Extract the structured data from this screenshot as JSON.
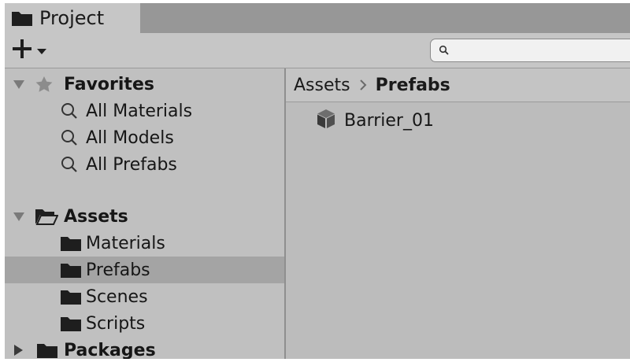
{
  "window": {
    "tab_label": "Project"
  },
  "toolbar": {
    "add_label": "+",
    "search_value": "",
    "search_placeholder": ""
  },
  "favorites": {
    "label": "Favorites",
    "items": [
      {
        "label": "All Materials",
        "icon": "search-icon"
      },
      {
        "label": "All Models",
        "icon": "search-icon"
      },
      {
        "label": "All Prefabs",
        "icon": "search-icon"
      }
    ]
  },
  "assets": {
    "label": "Assets",
    "folders": [
      {
        "label": "Materials"
      },
      {
        "label": "Prefabs",
        "selected": true
      },
      {
        "label": "Scenes"
      },
      {
        "label": "Scripts"
      }
    ]
  },
  "packages": {
    "label": "Packages"
  },
  "breadcrumb": {
    "root": "Assets",
    "current": "Prefabs"
  },
  "content": {
    "items": [
      {
        "label": "Barrier_01",
        "icon": "prefab-cube-icon"
      }
    ]
  }
}
